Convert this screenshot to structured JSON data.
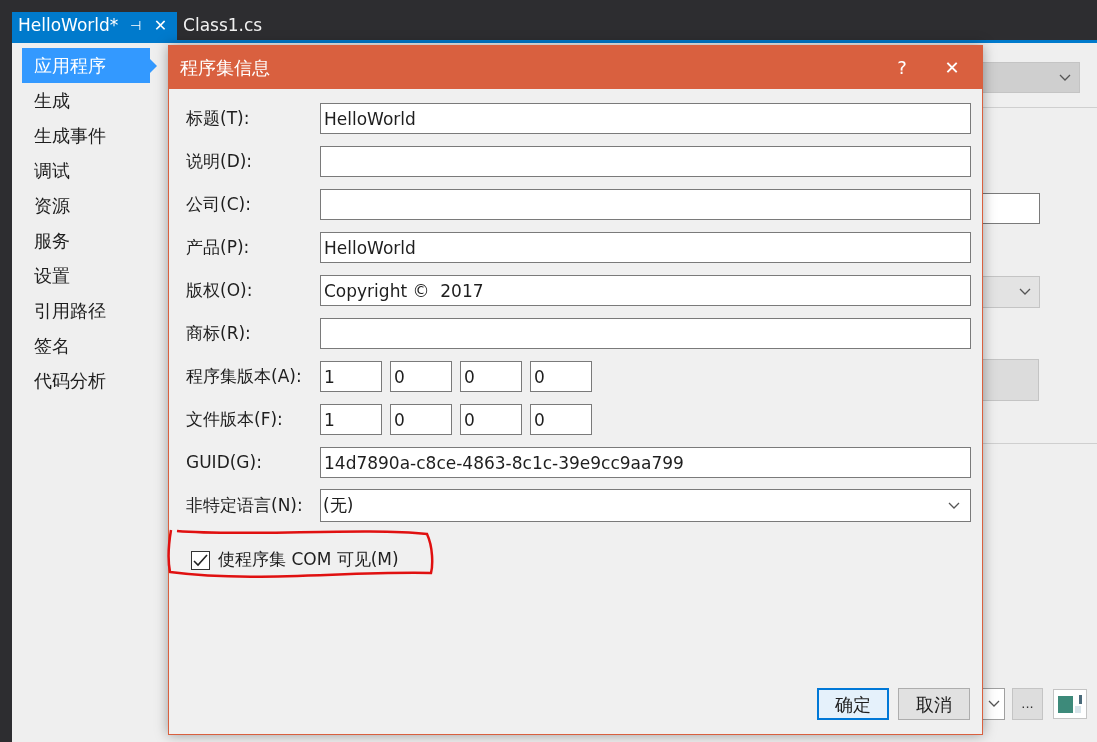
{
  "tabs": [
    {
      "label": "HelloWorld*",
      "selected": true,
      "pin": "⊣",
      "close": "✕"
    },
    {
      "label": "Class1.cs",
      "selected": false
    }
  ],
  "sidebar": {
    "items": [
      {
        "label": "应用程序",
        "selected": true
      },
      {
        "label": "生成",
        "selected": false
      },
      {
        "label": "生成事件",
        "selected": false
      },
      {
        "label": "调试",
        "selected": false
      },
      {
        "label": "资源",
        "selected": false
      },
      {
        "label": "服务",
        "selected": false
      },
      {
        "label": "设置",
        "selected": false
      },
      {
        "label": "引用路径",
        "selected": false
      },
      {
        "label": "签名",
        "selected": false
      },
      {
        "label": "代码分析",
        "selected": false
      }
    ]
  },
  "background": {
    "browse_button": "..."
  },
  "dialog": {
    "title": "程序集信息",
    "help": "?",
    "close": "✕",
    "fields": [
      {
        "kind": "text",
        "label": "标题(T):",
        "value": "HelloWorld"
      },
      {
        "kind": "text",
        "label": "说明(D):"
      },
      {
        "kind": "text",
        "label": "公司(C):"
      },
      {
        "kind": "text",
        "label": "产品(P):",
        "value": "HelloWorld"
      },
      {
        "kind": "text",
        "label": "版权(O):",
        "value": "Copyright ©  2017"
      },
      {
        "kind": "text",
        "label": "商标(R):"
      },
      {
        "kind": "version",
        "label": "程序集版本(A):",
        "parts": [
          "1",
          "0",
          "0",
          "0"
        ]
      },
      {
        "kind": "version",
        "label": "文件版本(F):",
        "parts": [
          "1",
          "0",
          "0",
          "0"
        ]
      },
      {
        "kind": "text",
        "label": "GUID(G):",
        "value": "14d7890a-c8ce-4863-8c1c-39e9cc9aa799"
      },
      {
        "kind": "combo",
        "label": "非特定语言(N):",
        "value": "(无)"
      }
    ],
    "com_visible": {
      "label": "使程序集 COM 可见(M)",
      "checked": true,
      "annotated": true
    },
    "buttons": [
      {
        "label": "确定",
        "default": true
      },
      {
        "label": "取消",
        "default": false
      }
    ]
  }
}
